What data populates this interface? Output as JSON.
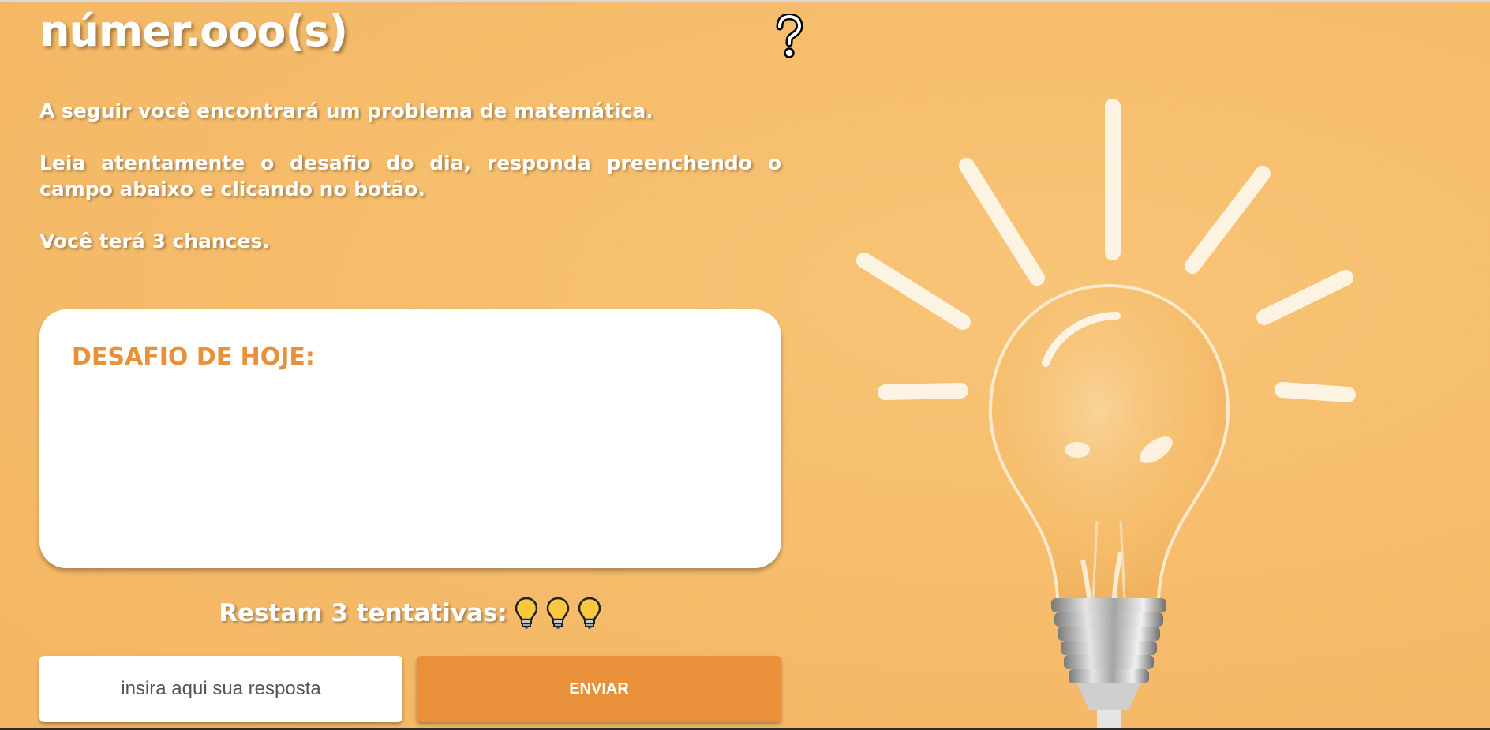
{
  "brand": {
    "title": "númer.ooo(s)"
  },
  "header": {
    "help_icon": "question-mark-icon"
  },
  "intro": {
    "paragraph_1": "A seguir você encontrará um problema de matemática.",
    "paragraph_2": "Leia atentamente o desafio do dia, responda preenchendo o campo abaixo e clicando no botão.",
    "paragraph_3": "Você terá 3 chances."
  },
  "challenge": {
    "title": "DESAFIO DE HOJE:",
    "body": ""
  },
  "attempts": {
    "label": "Restam 3 tentativas:",
    "remaining": 3,
    "icon": "lightbulb-icon"
  },
  "answer": {
    "placeholder": "insira aqui sua resposta",
    "value": ""
  },
  "actions": {
    "send_label": "ENVIAR"
  },
  "illustration": {
    "icon": "lightbulb-illustration"
  },
  "colors": {
    "background": "#f6bd6c",
    "accent": "#e8913a",
    "card": "#ffffff",
    "text_on_bg": "#ffffff"
  }
}
